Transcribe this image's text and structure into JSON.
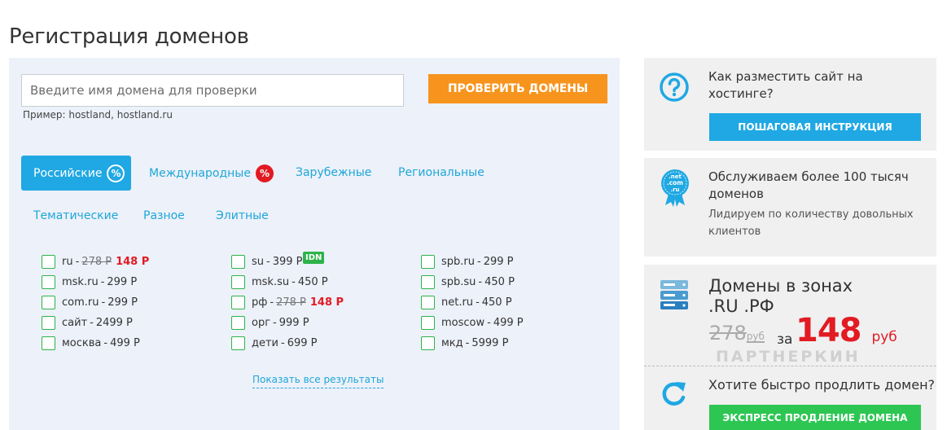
{
  "page": {
    "title": "Регистрация доменов"
  },
  "search": {
    "placeholder": "Введите имя домена для проверки",
    "example": "Пример: hostland, hostland.ru",
    "button_label": "ПРОВЕРИТЬ ДОМЕНЫ"
  },
  "tabs": [
    {
      "label": "Российские",
      "active": true,
      "badge": "%"
    },
    {
      "label": "Международные",
      "active": false,
      "badge": "%"
    },
    {
      "label": "Зарубежные",
      "active": false
    },
    {
      "label": "Региональные",
      "active": false
    },
    {
      "label": "Тематические",
      "active": false
    },
    {
      "label": "Разное",
      "active": false
    },
    {
      "label": "Элитные",
      "active": false
    }
  ],
  "domains": {
    "col1": [
      {
        "zone": "ru",
        "old_price": "278 Р",
        "price": "148 Р"
      },
      {
        "zone": "msk.ru",
        "price": "299 Р"
      },
      {
        "zone": "com.ru",
        "price": "299 Р"
      },
      {
        "zone": "сайт",
        "price": "2499 Р"
      },
      {
        "zone": "москва",
        "price": "499 Р"
      }
    ],
    "col2": [
      {
        "zone": "su",
        "price": "399 Р"
      },
      {
        "zone": "msk.su",
        "price": "450 Р"
      },
      {
        "zone": "рф",
        "old_price": "278 Р",
        "price": "148 Р"
      },
      {
        "zone": "орг",
        "price": "999 Р"
      },
      {
        "zone": "дети",
        "price": "699 Р"
      }
    ],
    "col3": [
      {
        "zone": "spb.ru",
        "price": "299 Р"
      },
      {
        "zone": "spb.su",
        "price": "450 Р"
      },
      {
        "zone": "net.ru",
        "price": "450 Р"
      },
      {
        "zone": "moscow",
        "price": "499 Р"
      },
      {
        "zone": "мкд",
        "price": "5999 Р"
      }
    ],
    "idn_badge": "IDN",
    "show_all": "Показать все результаты"
  },
  "sidebar": {
    "help": {
      "title_line1": "Как разместить сайт на",
      "title_line2": "хостинге?",
      "button": "ПОШАГОВАЯ ИНСТРУКЦИЯ",
      "icon": "question-icon"
    },
    "service": {
      "title_line1": "Обслуживаем более 100 тысяч",
      "title_line2": "доменов",
      "sub_line1": "Лидируем по количеству довольных",
      "sub_line2": "клиентов",
      "icon": "net-com-ru-seal-icon",
      "seal_lines": [
        ".net",
        ".com",
        ".ru"
      ]
    },
    "promo": {
      "title_line1": "Домены в зонах",
      "title_line2": ".RU .РФ",
      "old_price": "278",
      "old_currency": "руб",
      "for": "за",
      "new_price": "148",
      "new_currency": "руб",
      "icon": "server-icon",
      "watermark": "ПАРТНЕРКИН"
    },
    "renew": {
      "title": "Хотите быстро продлить домен?",
      "button": "ЭКСПРЕСС ПРОДЛЕНИЕ ДОМЕНА",
      "icon": "refresh-icon"
    }
  },
  "colors": {
    "accent_blue": "#1fa8e3",
    "orange": "#f7941d",
    "sale_red": "#e21b23",
    "green": "#2dc653"
  }
}
